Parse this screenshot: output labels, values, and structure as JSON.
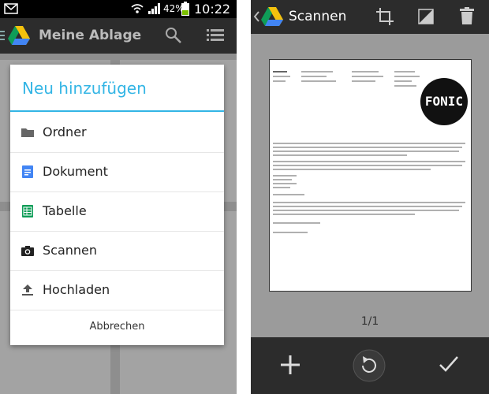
{
  "left": {
    "status_bar": {
      "battery": "42%",
      "time": "10:22"
    },
    "action_bar": {
      "title": "Meine Ablage"
    },
    "dialog": {
      "title": "Neu hinzufügen",
      "items": [
        {
          "label": "Ordner",
          "icon": "folder-icon"
        },
        {
          "label": "Dokument",
          "icon": "document-icon"
        },
        {
          "label": "Tabelle",
          "icon": "spreadsheet-icon"
        },
        {
          "label": "Scannen",
          "icon": "camera-icon"
        },
        {
          "label": "Hochladen",
          "icon": "upload-icon"
        }
      ],
      "cancel_label": "Abbrechen"
    }
  },
  "right": {
    "action_bar": {
      "title": "Scannen"
    },
    "document": {
      "logo_text": "FONIC"
    },
    "pager": "1/1"
  },
  "colors": {
    "accent": "#33b5e5",
    "action_bar": "#2c2c2c",
    "doc_icon": "#4285f4",
    "sheet_icon": "#0f9d58"
  }
}
